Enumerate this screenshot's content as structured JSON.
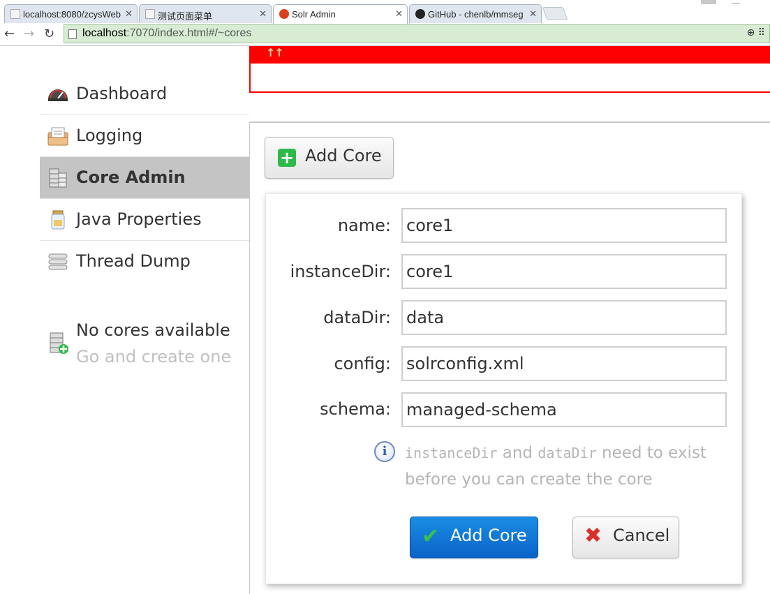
{
  "browser": {
    "tabs": [
      {
        "label": "localhost:8080/zcysWeb",
        "favicon": "page-icon"
      },
      {
        "label": "测试页面菜单",
        "favicon": "page-icon"
      },
      {
        "label": "Solr Admin",
        "favicon": "solr-icon"
      },
      {
        "label": "GitHub - chenlb/mmseg",
        "favicon": "github-icon"
      }
    ],
    "address": {
      "host": "localhost",
      "rest": ":7070/index.html#/~cores"
    }
  },
  "sidebar": {
    "items": [
      {
        "label": "Dashboard",
        "icon": "dashboard-icon"
      },
      {
        "label": "Logging",
        "icon": "logging-icon"
      },
      {
        "label": "Core Admin",
        "icon": "core-admin-icon",
        "active": true
      },
      {
        "label": "Java Properties",
        "icon": "java-properties-icon"
      },
      {
        "label": "Thread Dump",
        "icon": "thread-dump-icon"
      }
    ],
    "no_cores": {
      "title": "No cores available",
      "subtitle": "Go and create one"
    }
  },
  "banner": {
    "glyph": "↑↑",
    "color": "#ff0000"
  },
  "main": {
    "add_core_button": "Add Core",
    "form": {
      "fields": [
        {
          "label": "name:",
          "value": "core1"
        },
        {
          "label": "instanceDir:",
          "value": "core1"
        },
        {
          "label": "dataDir:",
          "value": "data"
        },
        {
          "label": "config:",
          "value": "solrconfig.xml"
        },
        {
          "label": "schema:",
          "value": "managed-schema"
        }
      ],
      "hint": {
        "code1": "instanceDir",
        "and": " and ",
        "code2": "dataDir",
        "rest1": " need to exist",
        "line2": "before you can create the core"
      },
      "submit_label": "Add Core",
      "cancel_label": "Cancel"
    }
  }
}
